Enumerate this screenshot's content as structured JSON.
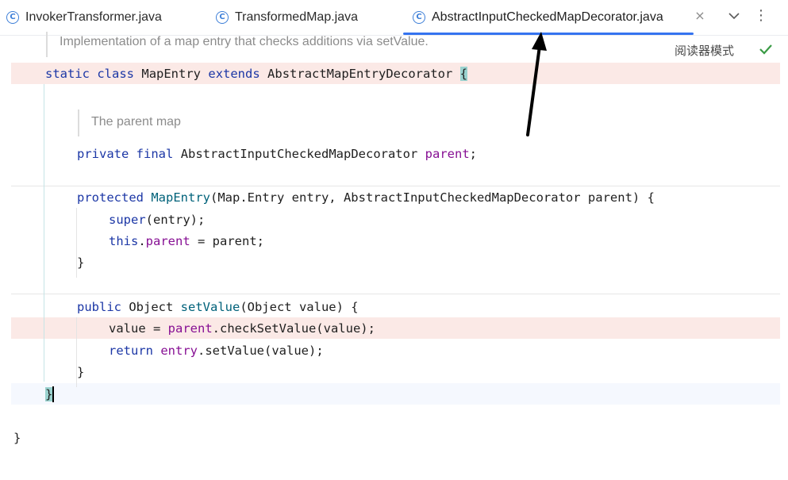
{
  "tabs": [
    {
      "label": "InvokerTransformer.java",
      "icon": "class-icon"
    },
    {
      "label": "TransformedMap.java",
      "icon": "class-icon"
    },
    {
      "label": "AbstractInputCheckedMapDecorator.java",
      "icon": "class-icon",
      "active": true
    }
  ],
  "tab_close_glyph": "×",
  "tab_menu_glyph": "⋮",
  "editor": {
    "doc_top": "Implementation of a map entry that checks additions via setValue.",
    "reader_mode_label": "阅读器模式",
    "doc_parent": "The parent map",
    "lines": {
      "class_decl": {
        "kw1": "static",
        "kw2": "class",
        "name": "MapEntry",
        "kw3": "extends",
        "super": "AbstractMapEntryDecorator",
        "brace": "{"
      },
      "field_decl": {
        "kw1": "private",
        "kw2": "final",
        "type": "AbstractInputCheckedMapDecorator",
        "name": "parent",
        "end": ";"
      },
      "ctor_decl": {
        "kw": "protected",
        "name": "MapEntry",
        "params": "(Map.Entry entry, AbstractInputCheckedMapDecorator parent) {"
      },
      "super_call": {
        "kw": "super",
        "rest": "(entry);"
      },
      "this_assign": {
        "kw": "this",
        "dot": ".",
        "field": "parent",
        "rest": " = parent;"
      },
      "ctor_close": "}",
      "method_decl": {
        "kw": "public",
        "type": " Object ",
        "name": "setValue",
        "params": "(Object value) {"
      },
      "value_assign": {
        "pre": "value = ",
        "field": "parent",
        "rest": ".checkSetValue(value);"
      },
      "return_stmt": {
        "kw": "return",
        "field": "entry",
        "rest": ".setValue(value);"
      },
      "method_close": "}",
      "class_close": "}",
      "outer_close": "}"
    }
  },
  "colors": {
    "keyword": "#1c37a6",
    "field": "#871094",
    "method": "#00627a",
    "active_tab_underline": "#3574f0",
    "highlight_line": "#fbe9e6",
    "check": "#3a9b45"
  }
}
